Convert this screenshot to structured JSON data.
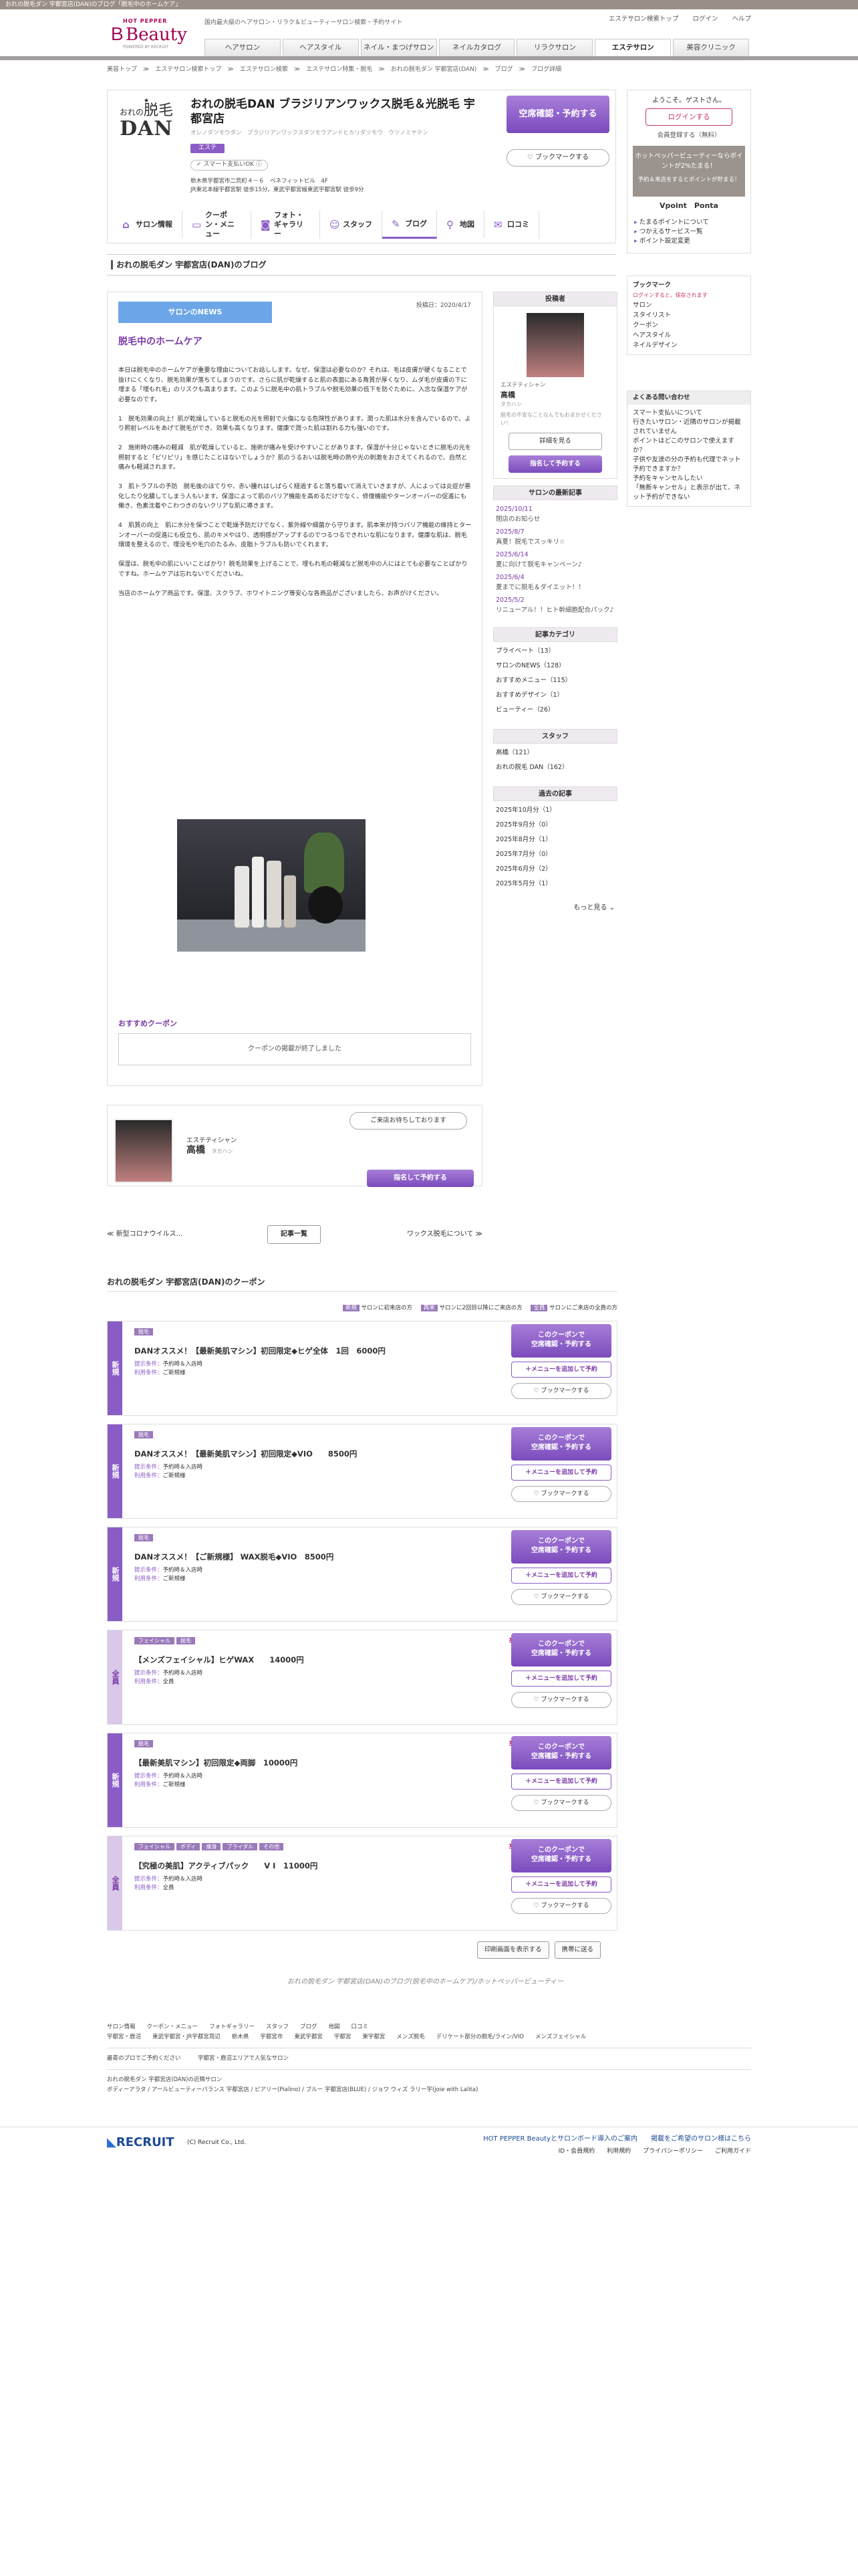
{
  "topbar": "おれの脱毛ダン 宇都宮店(DAN)のブログ「脱毛中のホームケア」",
  "header": {
    "brand_top": "HOT PEPPER",
    "brand": "Beauty",
    "powered": "POWERED BY RECRUIT",
    "tagline": "国内最大級のヘアサロン・リラク＆ビューティーサロン検索・予約サイト",
    "links": [
      "エステサロン検索トップ",
      "ログイン",
      "ヘルプ"
    ],
    "nav": [
      "ヘアサロン",
      "ヘアスタイル",
      "ネイル・まつげサロン",
      "ネイルカタログ",
      "リラクサロン",
      "エステサロン",
      "美容クリニック"
    ]
  },
  "breadcrumb": "美容トップ　≫　エステサロン検索トップ　≫　エステサロン検索　≫　エステサロン特集・脱毛　≫　おれの脱毛ダン 宇都宮店(DAN)　≫　ブログ　≫　ブログ詳細",
  "salon": {
    "logo_line1": "おれの",
    "logo_line2": "脱毛",
    "logo_line3": "DAN",
    "name": "おれの脱毛DAN ブラジリアンワックス脱毛＆光脱毛 宇都宮店",
    "kana": "オレノダツモウダン　ブラジリアンワックスダツモウアンドヒカリダツモウ　ウツノミヤテン",
    "badge": "エステ",
    "smart": "スマート支払いOK",
    "addr1": "栃木県宇都宮市二荒町４－６　ベネフィットビル　4F",
    "addr2": "JR東北本線宇都宮駅 徒歩15分。東武宇都宮線東武宇都宮駅 徒歩9分",
    "reserve": "空席確認・予約する",
    "bookmark": "ブックマークする",
    "tabs": [
      "サロン情報",
      "クーポン・メニュー",
      "フォト・ギャラリー",
      "スタッフ",
      "ブログ",
      "地図",
      "口コミ"
    ]
  },
  "sidebar": {
    "welcome": "ようこそ。ゲストさん。",
    "login": "ログインする",
    "register": "会員登録する（無料）",
    "promo": "ホットペッパービューティーならポイントが2%たまる！",
    "promo2": "予約＆来店をするとポイントが貯まる！",
    "points": "Vpoint　Ponta",
    "links": [
      "たまるポイントについて",
      "つかえるサービス一覧",
      "ポイント設定変更"
    ],
    "bm_title": "ブックマーク",
    "bm_note": "ログインすると、保存されます",
    "bm_items": [
      "サロン",
      "スタイリスト",
      "クーポン",
      "ヘアスタイル",
      "ネイルデザイン"
    ],
    "faq_title": "よくある問い合わせ",
    "faq": [
      "スマート支払いについて",
      "行きたいサロン・近隣のサロンが掲載されていません",
      "ポイントはどこのサロンで使えますか？",
      "子供や友達の分の予約も代理でネット予約できますか？",
      "予約をキャンセルしたい",
      "「無断キャンセル」と表示が出て、ネット予約ができない"
    ]
  },
  "page_title": "おれの脱毛ダン 宇都宮店(DAN)のブログ",
  "blog": {
    "category": "サロンのNEWS",
    "date": "投稿日：2020/4/17",
    "title": "脱毛中のホームケア",
    "paragraphs": [
      "本日は脱毛中のホームケアが重要な理由についてお話しします。なぜ、保湿は必要なのか？それは、毛は皮膚が硬くなることで抜けにくくなり、脱毛効果が落ちてしまうのです。さらに肌が乾燥すると肌の表面にある角質が厚くなり、ムダ毛が皮膚の下に埋まる「埋もれ毛」のリスクも高まります。このように脱毛中の肌トラブルや脱毛効果の低下を防ぐために、入念な保湿ケアが必要なのです。",
      "1　脱毛効果の向上！肌が乾燥していると脱毛の光を照射で火傷になる危険性があります。潤った肌は水分を含んでいるので、より照射レベルをあげて脱毛ができ、効果も高くなります。健康で潤った肌は割れる力も強いのです。",
      "2　施術時の痛みの軽減　肌が乾燥していると、施術が痛みを受けやすいことがあります。保湿が十分じゃないときに脱毛の光を照射すると「ピリピリ」を感じたことはないでしょうか？肌のうるおいは脱毛時の熱や光の刺激をおさえてくれるので、自然と痛みも軽減されます。",
      "3　肌トラブルの予防　脱毛後のほてりや、赤い腫れはしばらく経過すると落ち着いて消えていきますが、人によっては炎症が悪化したり化膿してしまう人もいます。保湿によって肌のバリア機能を高めるだけでなく、修復機能やターンオーバーの促進にも働き、色素沈着やこわつきのないクリアな肌に導きます。",
      "4　肌質の向上　肌に水分を保つことで乾燥予防だけでなく、紫外線や細菌から守ります。肌本来が持つバリア機能の維持とターンオーバーの促進にも役立ち、肌のキメやはり、透明感がアップするのでつるつるできれいな肌になります。健康な肌は、脱毛環境を整えるので、埋没毛や毛穴のたるみ、皮脂トラブルも防いでくれます。",
      "保湿は、脱毛中の肌にいいことばかり！脱毛効果を上げることで、埋もれ毛の軽減など脱毛中の人にはとても必要なことばかりですね。ホームケアは忘れないでくださいね。",
      "当店のホームケア商品です。保湿、スクラブ、ホワイトニング等安心な各商品がございましたら、お声がけください。"
    ],
    "coupon_title": "おすすめクーポン",
    "coupon_empty": "クーポンの掲載が終了しました"
  },
  "stylist": {
    "bubble": "ご来店お待ちしております",
    "role": "エステティシャン",
    "name": "高橋",
    "kana": "タカハシ",
    "reserve": "指名して予約する"
  },
  "blognav": {
    "prev": "≪ 新型コロナウイルス...",
    "list": "記事一覧",
    "next": "ワックス脱毛について ≫"
  },
  "rail": {
    "poster": "投稿者",
    "role": "エステティシャン",
    "name": "高橋",
    "kana": "タカハシ",
    "msg": "脱毛の不安なことなんでもおまかせください！",
    "detail": "詳細を見る",
    "reserve": "指名して予約する",
    "recent_title": "サロンの最新記事",
    "recent": [
      {
        "d": "2025/10/11",
        "t": "閉店のお知らせ"
      },
      {
        "d": "2025/8/7",
        "t": "真夏！脱毛でスッキリ☆"
      },
      {
        "d": "2025/6/14",
        "t": "夏に向けて脱毛キャンペーン♪"
      },
      {
        "d": "2025/6/4",
        "t": "夏までに脱毛＆ダイエット！！"
      },
      {
        "d": "2025/5/2",
        "t": "リニューアル！！ヒト幹細胞配合パック♪"
      }
    ],
    "cat_title": "記事カテゴリ",
    "cats": [
      "プライベート（13）",
      "サロンのNEWS（128）",
      "おすすめメニュー（115）",
      "おすすめデザイン（1）",
      "ビューティー（26）"
    ],
    "staff_title": "スタッフ",
    "staff": [
      "高橋（121）",
      "おれの脱毛 DAN（162）"
    ],
    "arch_title": "過去の記事",
    "arch": [
      "2025年10月分（1）",
      "2025年9月分（0）",
      "2025年8月分（1）",
      "2025年7月分（0）",
      "2025年6月分（2）",
      "2025年5月分（1）"
    ],
    "more": "もっと見る"
  },
  "coupons": {
    "title": "おれの脱毛ダン 宇都宮店(DAN)のクーポン",
    "legend": [
      {
        "k": "新規",
        "v": "サロンに初来店の方"
      },
      {
        "k": "再来",
        "v": "サロンに2回目以降にご来店の方"
      },
      {
        "k": "全員",
        "v": "サロンにご来店の全員の方"
      }
    ],
    "btn1": "このクーポンで\n空席確認・予約する",
    "btn2": "＋メニューを追加して予約",
    "btn3": "ブックマークする",
    "list": [
      {
        "type": "新規",
        "tags": [
          "脱毛"
        ],
        "price": "¥6,000",
        "name": "DANオススメ！【最新美肌マシン】初回限定◆ヒゲ全体　1回　6000円",
        "cond1": "予約時＆入店時",
        "cond2": "ご新規様"
      },
      {
        "type": "新規",
        "tags": [
          "脱毛"
        ],
        "price": "¥8,500",
        "name": "DANオススメ！【最新美肌マシン】初回限定◆VIO　　8500円",
        "cond1": "予約時＆入店時",
        "cond2": "ご新規様"
      },
      {
        "type": "新規",
        "tags": [
          "脱毛"
        ],
        "price": "¥8,500",
        "name": "DANオススメ！【ご新規様】 WAX脱毛◆VIO　8500円",
        "cond1": "予約時＆入店時",
        "cond2": "ご新規様"
      },
      {
        "type": "全員",
        "tags": [
          "フェイシャル",
          "脱毛"
        ],
        "price": "¥14,000",
        "name": "【メンズフェイシャル】ヒゲWAX　　14000円",
        "cond1": "予約時＆入店時",
        "cond2": "全員"
      },
      {
        "type": "新規",
        "tags": [
          "脱毛"
        ],
        "price": "¥10,000",
        "name": "【最新美肌マシン】初回限定◆両脚　10000円",
        "cond1": "予約時＆入店時",
        "cond2": "ご新規様"
      },
      {
        "type": "全員",
        "tags": [
          "フェイシャル",
          "ボディ",
          "痩身",
          "ブライダル",
          "その他"
        ],
        "price": "¥11,000",
        "name": "【究極の美肌】アクティブパック　　Ⅴ Ⅰ　11000円",
        "cond1": "予約時＆入店時",
        "cond2": "全員"
      }
    ],
    "label_cond1": "提示条件：",
    "label_cond2": "利用条件："
  },
  "printbtns": [
    "印刷画面を表示する",
    "携帯に送る"
  ],
  "slogan": "おれの脱毛ダン 宇都宮店(DAN)のブログ(脱毛中のホームケア)/ホットペッパービューティー",
  "fnav": {
    "l1": "サロン情報　　クーポン・メニュー　　フォトギャラリー　　スタッフ　　ブログ　　地図　　口コミ",
    "l2": "宇都宮・鹿沼　　東武宇都宮・JR宇都宮周辺　　栃木県　　宇都宮市　　東武宇都宮　　宇都宮　　東宇都宮　　メンズ脱毛　　デリケート部分の脱毛/ライン/VIO　　メンズフェイシャル",
    "l3": "最寄のプロでご予約ください　　　宇都宮・鹿沼エリアで人気なサロン",
    "l4": "おれの脱毛ダン 宇都宮店(DAN)の近隣サロン",
    "l5": "ボディーアラタ / アールビューティーバランス 宇都宮店 / ピアリー(Pialino) / ブルー 宇都宮店(BLUE) / ジョワ ウィズ ラリー宇(joie with Lalita)"
  },
  "footer": {
    "logo": "RECRUIT",
    "copy": "(C) Recruit Co., Ltd.",
    "l1": "HOT PEPPER Beautyとサロンボード導入のご案内　　掲載をご希望のサロン様はこちら",
    "l2": "ID・会員規約　　利用規約　　プライバシーポリシー　　ご利用ガイド"
  },
  "colors": {
    "accent": "#8a5cc6",
    "brand": "#a0004f",
    "price": "#c8346c"
  }
}
